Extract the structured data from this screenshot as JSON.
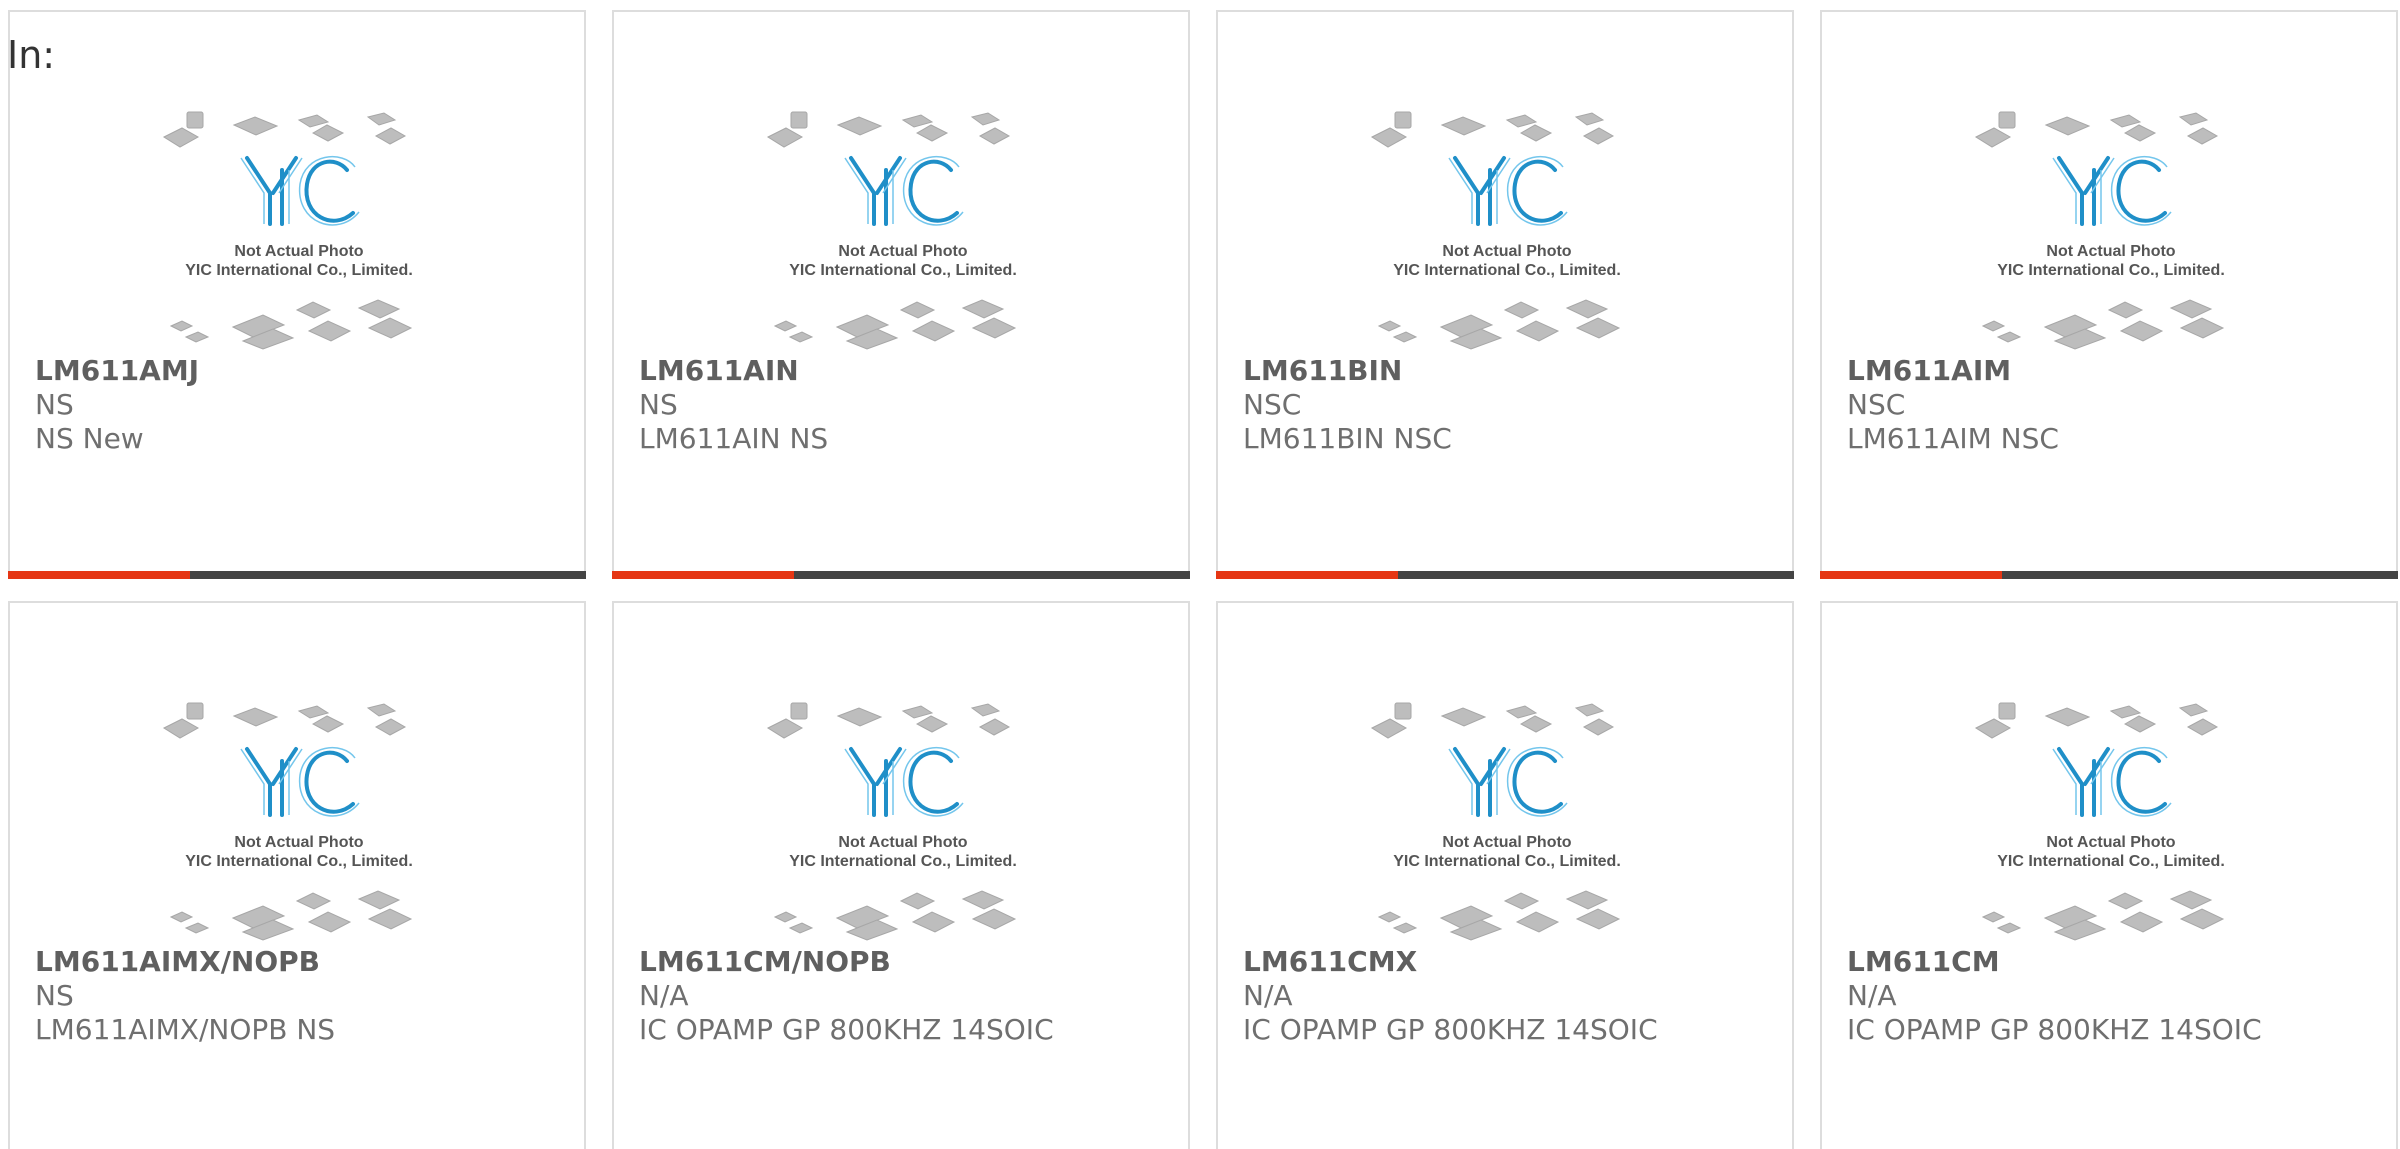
{
  "header": {
    "label": "In:"
  },
  "image": {
    "line1": "Not Actual Photo",
    "line2": "YIC International Co., Limited."
  },
  "colors": {
    "accent": "#e53614",
    "bar": "#444444",
    "logo": "#1f8fc8"
  },
  "products": [
    {
      "part": "LM611AMJ",
      "brand": "NS",
      "description": "NS New"
    },
    {
      "part": "LM611AIN",
      "brand": "NS",
      "description": "LM611AIN NS"
    },
    {
      "part": "LM611BIN",
      "brand": "NSC",
      "description": "LM611BIN NSC"
    },
    {
      "part": "LM611AIM",
      "brand": "NSC",
      "description": "LM611AIM NSC"
    },
    {
      "part": "LM611AIMX/NOPB",
      "brand": "NS",
      "description": "LM611AIMX/NOPB NS"
    },
    {
      "part": "LM611CM/NOPB",
      "brand": "N/A",
      "description": "IC OPAMP GP 800KHZ 14SOIC"
    },
    {
      "part": "LM611CMX",
      "brand": "N/A",
      "description": "IC OPAMP GP 800KHZ 14SOIC"
    },
    {
      "part": "LM611CM",
      "brand": "N/A",
      "description": "IC OPAMP GP 800KHZ 14SOIC"
    }
  ]
}
